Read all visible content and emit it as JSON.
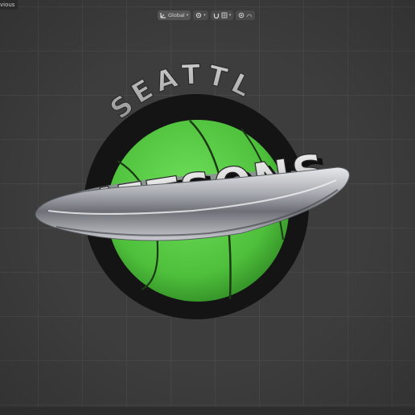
{
  "window": {
    "top_label": "vious"
  },
  "header": {
    "orientation_label": "Global",
    "pivot_icon": "transform-orientation-icon",
    "snap_icon": "snap-icon",
    "proportional_icon": "proportional-editing-icon",
    "overlay_icon": "overlay-icon"
  },
  "logo": {
    "line1": "SEATTLE",
    "line2": "JETSONS"
  },
  "colors": {
    "ball_green": "#5fcf4a",
    "ring_chrome": "#b9bcc2",
    "outline_black": "#141414",
    "grid_bg": "#3d3d3d"
  }
}
